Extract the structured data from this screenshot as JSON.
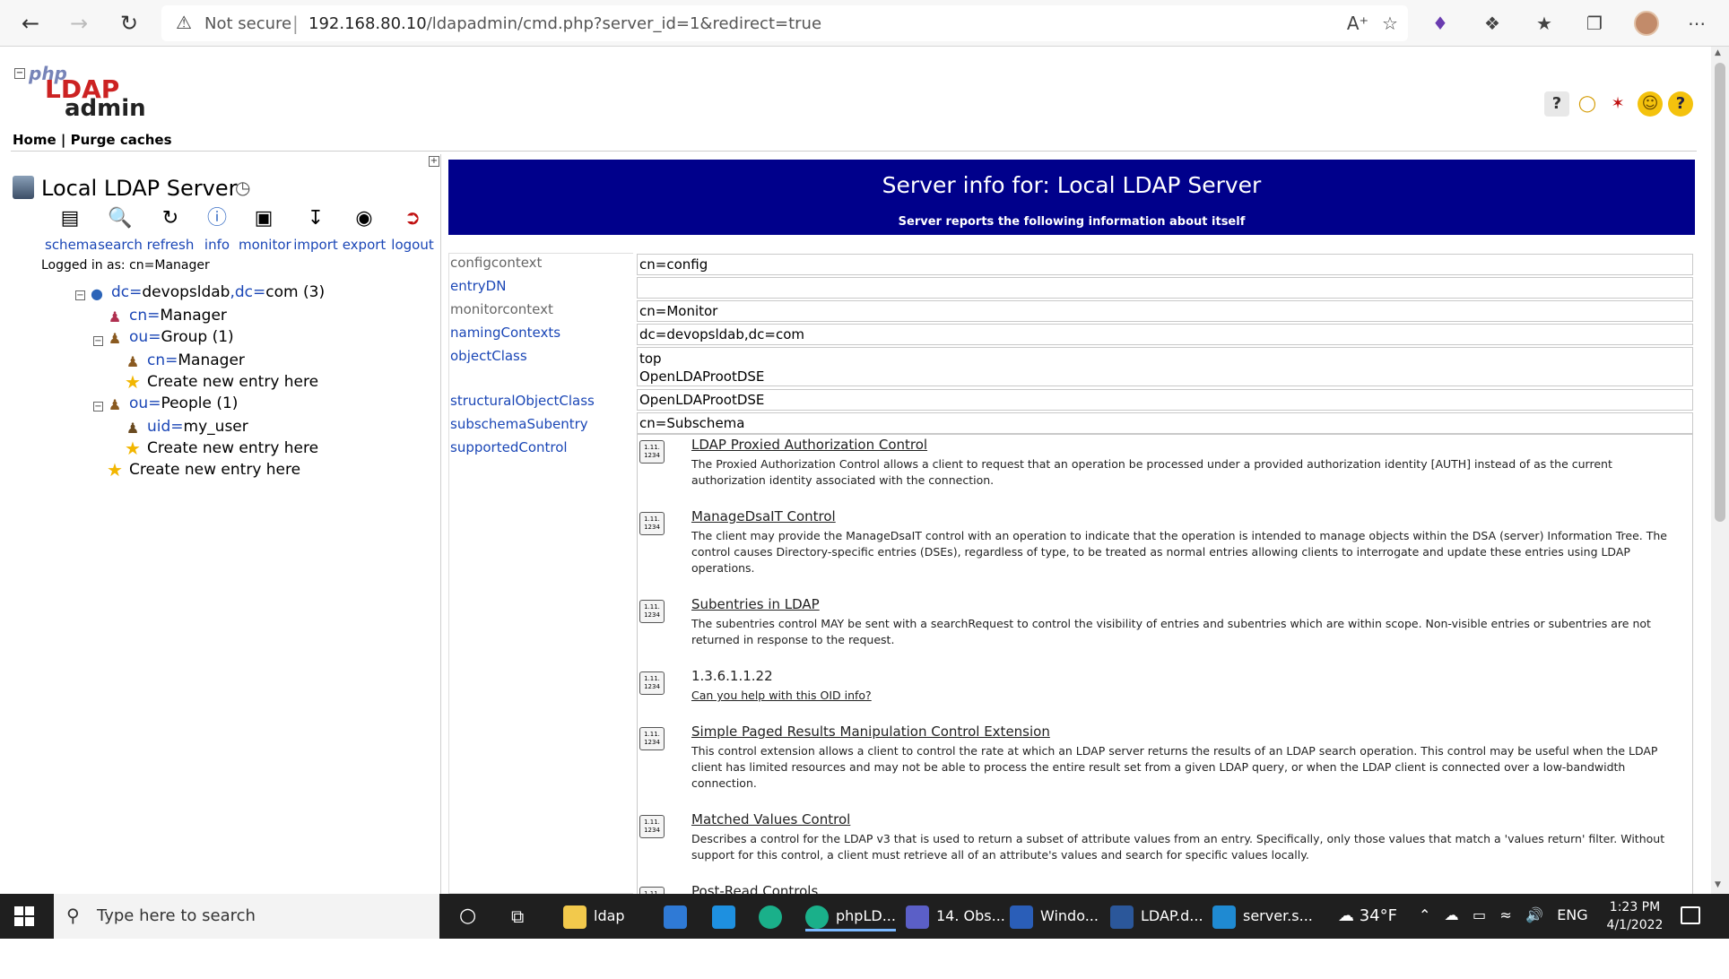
{
  "browser": {
    "security_label": "Not secure",
    "url_host": "192.168.80.10",
    "url_path": "/ldapadmin/cmd.php?server_id=1&redirect=true"
  },
  "app": {
    "logo_php": "php",
    "logo_ldap": "LDAP",
    "logo_admin": "admin",
    "menu_home": "Home",
    "menu_separator": "|",
    "menu_purge": "Purge caches"
  },
  "server": {
    "name": "Local LDAP Server",
    "logged_in_as": "Logged in as: cn=Manager",
    "tools": [
      "schema",
      "search",
      "refresh",
      "info",
      "monitor",
      "import",
      "export",
      "logout"
    ]
  },
  "tree": {
    "root_key": "dc",
    "root_val": "devopsldab",
    "root_key2": "dc",
    "root_val2": "com",
    "root_count": "(3)",
    "manager_key": "cn",
    "manager_val": "Manager",
    "group_key": "ou",
    "group_val": "Group",
    "group_count": "(1)",
    "group_child_key": "cn",
    "group_child_val": "Manager",
    "people_key": "ou",
    "people_val": "People",
    "people_count": "(1)",
    "people_child_key": "uid",
    "people_child_val": "my_user",
    "create_label": "Create new entry here"
  },
  "main": {
    "title": "Server info for: Local LDAP Server",
    "subtitle": "Server reports the following information about itself",
    "attributes": [
      {
        "name": "configcontext",
        "value": "cn=config"
      },
      {
        "name": "entryDN",
        "value": ""
      },
      {
        "name": "monitorcontext",
        "value": "cn=Monitor"
      },
      {
        "name": "namingContexts",
        "value": "dc=devopsldab,dc=com"
      },
      {
        "name": "objectClass",
        "value": "top",
        "value2": "OpenLDAProotDSE"
      },
      {
        "name": "structuralObjectClass",
        "value": "OpenLDAProotDSE"
      },
      {
        "name": "subschemaSubentry",
        "value": "cn=Subschema"
      },
      {
        "name": "supportedControl"
      }
    ],
    "controls": [
      {
        "name": "LDAP Proxied Authorization Control",
        "desc": "The Proxied Authorization Control allows a client to request that an operation be processed under a provided authorization identity [AUTH] instead of as the current authorization identity associated with the connection."
      },
      {
        "name": "ManageDsaIT Control",
        "desc": "The client may provide the ManageDsaIT control with an operation to indicate that the operation is intended to manage objects within the DSA (server) Information Tree. The control causes Directory-specific entries (DSEs), regardless of type, to be treated as normal entries allowing clients to interrogate and update these entries using LDAP operations."
      },
      {
        "name": "Subentries in LDAP",
        "desc": "The subentries control MAY be sent with a searchRequest to control the visibility of entries and subentries which are within scope. Non-visible entries or subentries are not returned in response to the request."
      },
      {
        "name": "1.3.6.1.1.22",
        "desc": "Can you help with this OID info?"
      },
      {
        "name": "Simple Paged Results Manipulation Control Extension",
        "desc": "This control extension allows a client to control the rate at which an LDAP server returns the results of an LDAP search operation. This control may be useful when the LDAP client has limited resources and may not be able to process the entire result set from a given LDAP query, or when the LDAP client is connected over a low-bandwidth connection."
      },
      {
        "name": "Matched Values Control",
        "desc": "Describes a control for the LDAP v3 that is used to return a subset of attribute values from an entry. Specifically, only those values that match a 'values return' filter. Without support for this control, a client must retrieve all of an attribute's values and search for specific values locally."
      },
      {
        "name": "Post-Read Controls",
        "desc": ""
      }
    ],
    "oid_icon_text": "1.11.\n1234"
  },
  "taskbar": {
    "search_placeholder": "Type here to search",
    "items": [
      "ldap",
      "phpLD...",
      "14. Obs...",
      "Windo...",
      "LDAP.d...",
      "server.s..."
    ],
    "weather": "34°F",
    "language": "ENG",
    "time": "1:23 PM",
    "date": "4/1/2022"
  },
  "colors": {
    "title_bg": "#00008b",
    "link": "#1a46b6",
    "taskbar_bg": "#1f1f1f"
  }
}
